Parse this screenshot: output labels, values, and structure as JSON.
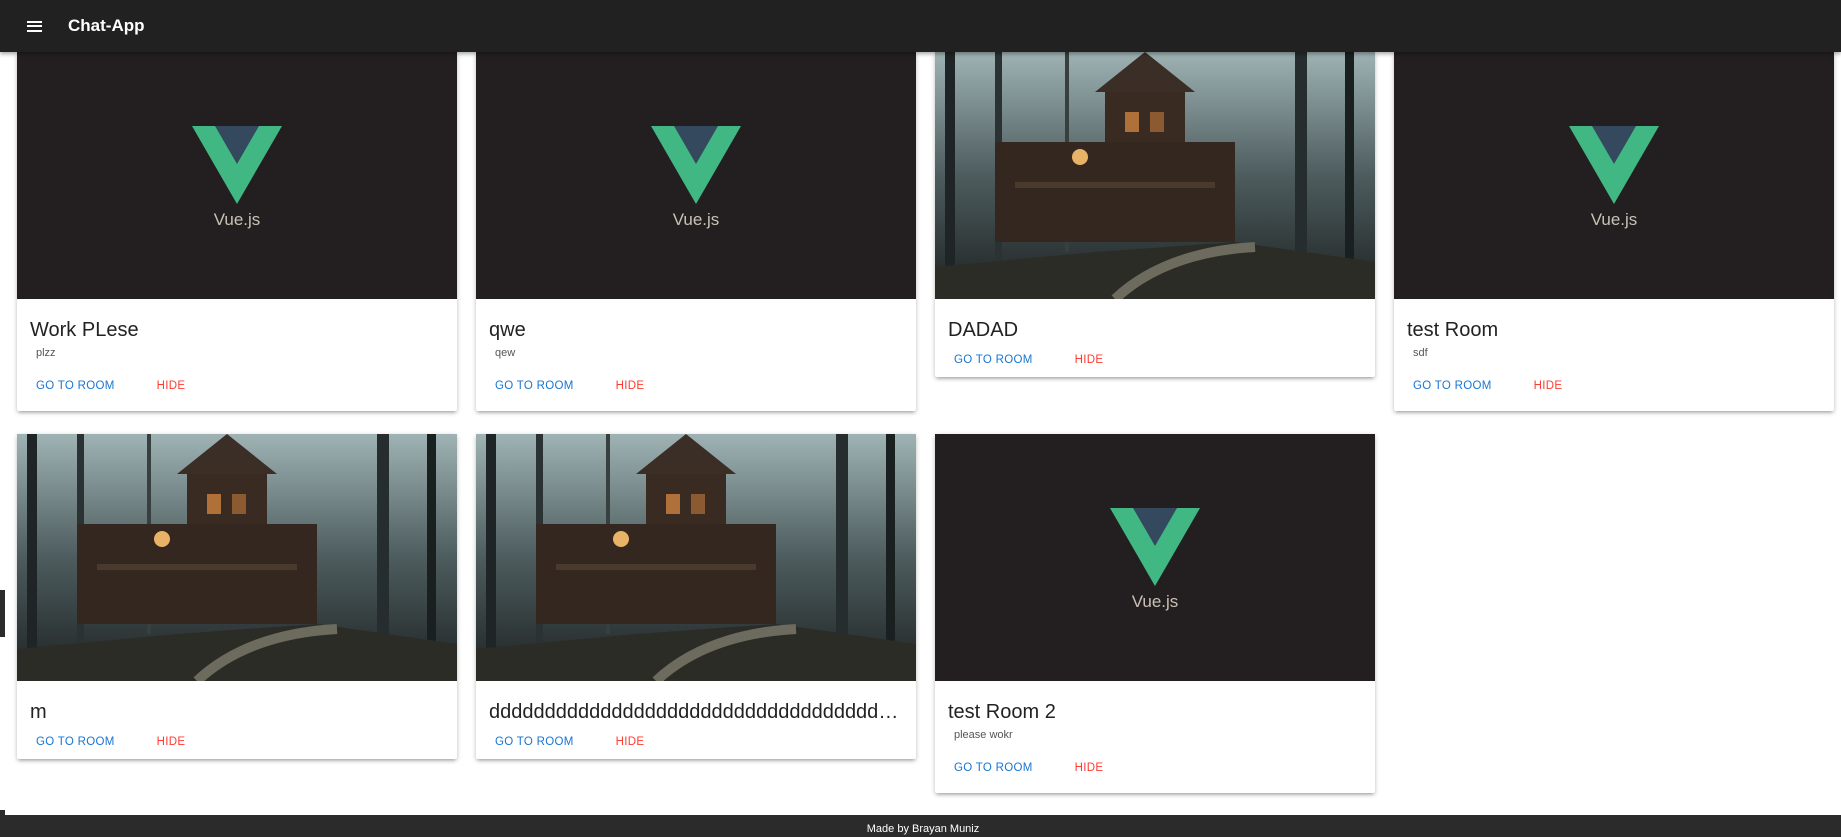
{
  "header": {
    "title": "Chat-App",
    "menu_icon": "hamburger-menu-icon"
  },
  "rooms": [
    {
      "title": "Work PLese",
      "subtitle": "plzz",
      "image": "vue-logo",
      "image_text": "Vue.js",
      "go_label": "GO TO ROOM",
      "hide_label": "HIDE"
    },
    {
      "title": "qwe",
      "subtitle": "qew",
      "image": "vue-logo",
      "image_text": "Vue.js",
      "go_label": "GO TO ROOM",
      "hide_label": "HIDE"
    },
    {
      "title": "DADAD",
      "subtitle": "",
      "image": "haunted-house",
      "go_label": "GO TO ROOM",
      "hide_label": "HIDE"
    },
    {
      "title": "test Room",
      "subtitle": "sdf",
      "image": "vue-logo",
      "image_text": "Vue.js",
      "go_label": "GO TO ROOM",
      "hide_label": "HIDE"
    },
    {
      "title": "m",
      "subtitle": "",
      "image": "haunted-house",
      "go_label": "GO TO ROOM",
      "hide_label": "HIDE"
    },
    {
      "title": "ddddddddddddddddddddddddddddddddddddd...",
      "subtitle": "",
      "image": "haunted-house",
      "go_label": "GO TO ROOM",
      "hide_label": "HIDE"
    },
    {
      "title": "test Room 2",
      "subtitle": "please wokr",
      "image": "vue-logo",
      "image_text": "Vue.js",
      "go_label": "GO TO ROOM",
      "hide_label": "HIDE"
    }
  ],
  "footer": {
    "text": "Made by Brayan Muniz"
  },
  "colors": {
    "topbar": "#212121",
    "go_button": "#1976d2",
    "hide_button": "#ff3b30",
    "vue_green": "#41b883",
    "vue_dark": "#34495e",
    "footer": "#2b2b2b"
  }
}
